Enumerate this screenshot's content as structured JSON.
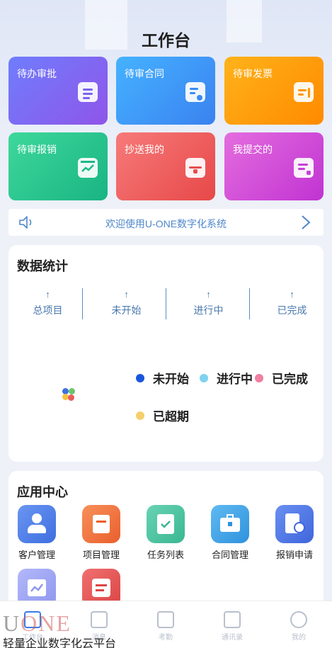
{
  "header": {
    "title": "工作台"
  },
  "tiles": [
    {
      "label": "待办审批"
    },
    {
      "label": "待审合同"
    },
    {
      "label": "待审发票"
    },
    {
      "label": "待审报销"
    },
    {
      "label": "抄送我的"
    },
    {
      "label": "我提交的"
    }
  ],
  "notice": {
    "text": "欢迎使用U-ONE数字化系统"
  },
  "stats": {
    "title": "数据统计",
    "items": [
      {
        "arrow": "↑",
        "label": "总项目"
      },
      {
        "arrow": "↑",
        "label": "未开始"
      },
      {
        "arrow": "↑",
        "label": "进行中"
      },
      {
        "arrow": "↑",
        "label": "已完成"
      }
    ],
    "legend": [
      {
        "label": "未开始",
        "color": "#1a56db"
      },
      {
        "label": "进行中",
        "color": "#7fd3f0"
      },
      {
        "label": "已完成",
        "color": "#f07fa0"
      },
      {
        "label": "已超期",
        "color": "#f5d06a"
      }
    ]
  },
  "apps": {
    "title": "应用中心",
    "items": [
      {
        "label": "客户管理",
        "icon": "customer-icon",
        "color": "#4f7de8"
      },
      {
        "label": "项目管理",
        "icon": "project-icon",
        "color": "#f07340"
      },
      {
        "label": "任务列表",
        "icon": "task-icon",
        "color": "#4cc3a0"
      },
      {
        "label": "合同管理",
        "icon": "contract-icon",
        "color": "#3fa3e6"
      },
      {
        "label": "报销申请",
        "icon": "reimburse-icon",
        "color": "#4f7de8"
      },
      {
        "label": "",
        "icon": "chart-icon",
        "color": "#9aa2f5"
      },
      {
        "label": "",
        "icon": "calendar-icon",
        "color": "#e85a5a"
      }
    ]
  },
  "tabbar": [
    {
      "label": "工作台"
    },
    {
      "label": "消息"
    },
    {
      "label": "考勤"
    },
    {
      "label": "通讯录"
    },
    {
      "label": "我的"
    }
  ],
  "watermark": {
    "logo": "ONE",
    "logo_u": "U",
    "slogan": "轻量企业数字化云平台"
  }
}
